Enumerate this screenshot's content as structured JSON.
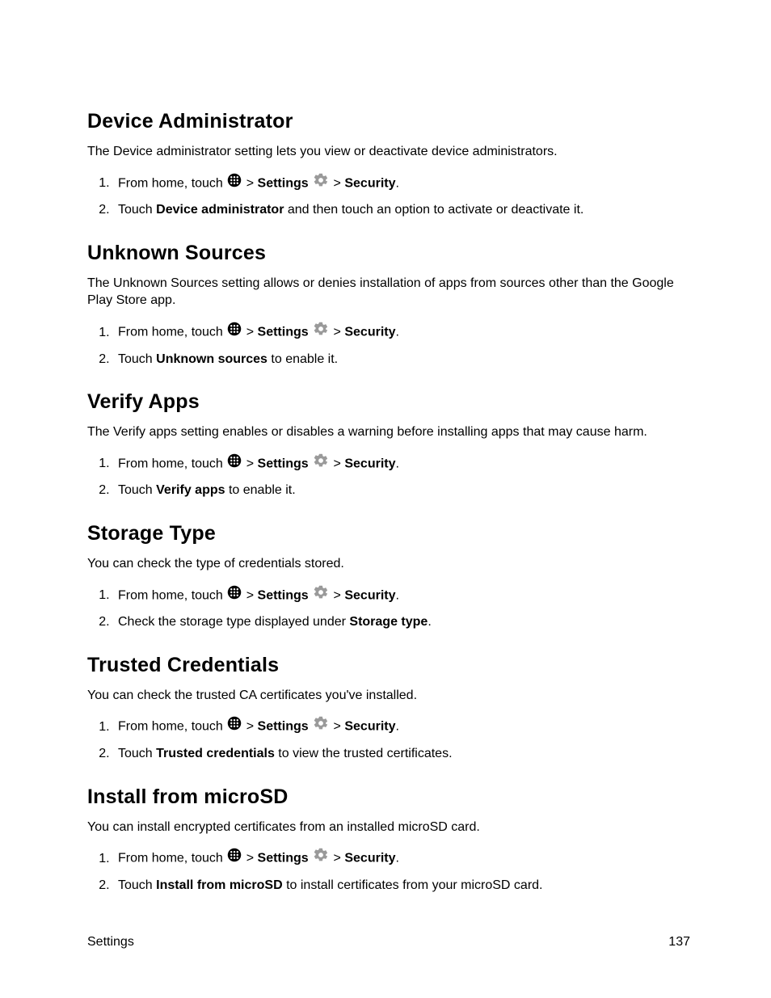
{
  "footer": {
    "section": "Settings",
    "page": "137"
  },
  "sections": [
    {
      "heading": "Device Administrator",
      "desc": "The Device administrator setting lets you view or deactivate device administrators.",
      "step2_prefix": "Touch ",
      "step2_bold": "Device administrator",
      "step2_suffix": " and then touch an option to activate or deactivate it."
    },
    {
      "heading": "Unknown Sources",
      "desc": "The Unknown Sources setting allows or denies installation of apps from sources other than the Google Play Store app.",
      "step2_prefix": "Touch ",
      "step2_bold": "Unknown sources",
      "step2_suffix": " to enable it."
    },
    {
      "heading": "Verify Apps",
      "desc": "The Verify apps setting enables or disables a warning before installing apps that may cause harm.",
      "step2_prefix": "Touch ",
      "step2_bold": "Verify apps",
      "step2_suffix": " to enable it."
    },
    {
      "heading": "Storage Type",
      "desc": "You can check the type of credentials stored.",
      "step2_prefix": "Check the storage type displayed under ",
      "step2_bold": "Storage type",
      "step2_suffix": "."
    },
    {
      "heading": "Trusted Credentials",
      "desc": "You can check the trusted CA certificates you've installed.",
      "step2_prefix": "Touch ",
      "step2_bold": "Trusted credentials",
      "step2_suffix": " to view the trusted certificates."
    },
    {
      "heading": "Install from microSD",
      "desc": "You can install encrypted certificates from an installed microSD card.",
      "step2_prefix": "Touch ",
      "step2_bold": "Install from microSD",
      "step2_suffix": " to install certificates from your microSD card."
    }
  ],
  "step1": {
    "prefix": "From home, touch ",
    "gt1": " > ",
    "settings": "Settings",
    "gt2": " > ",
    "security": "Security",
    "period": "."
  }
}
